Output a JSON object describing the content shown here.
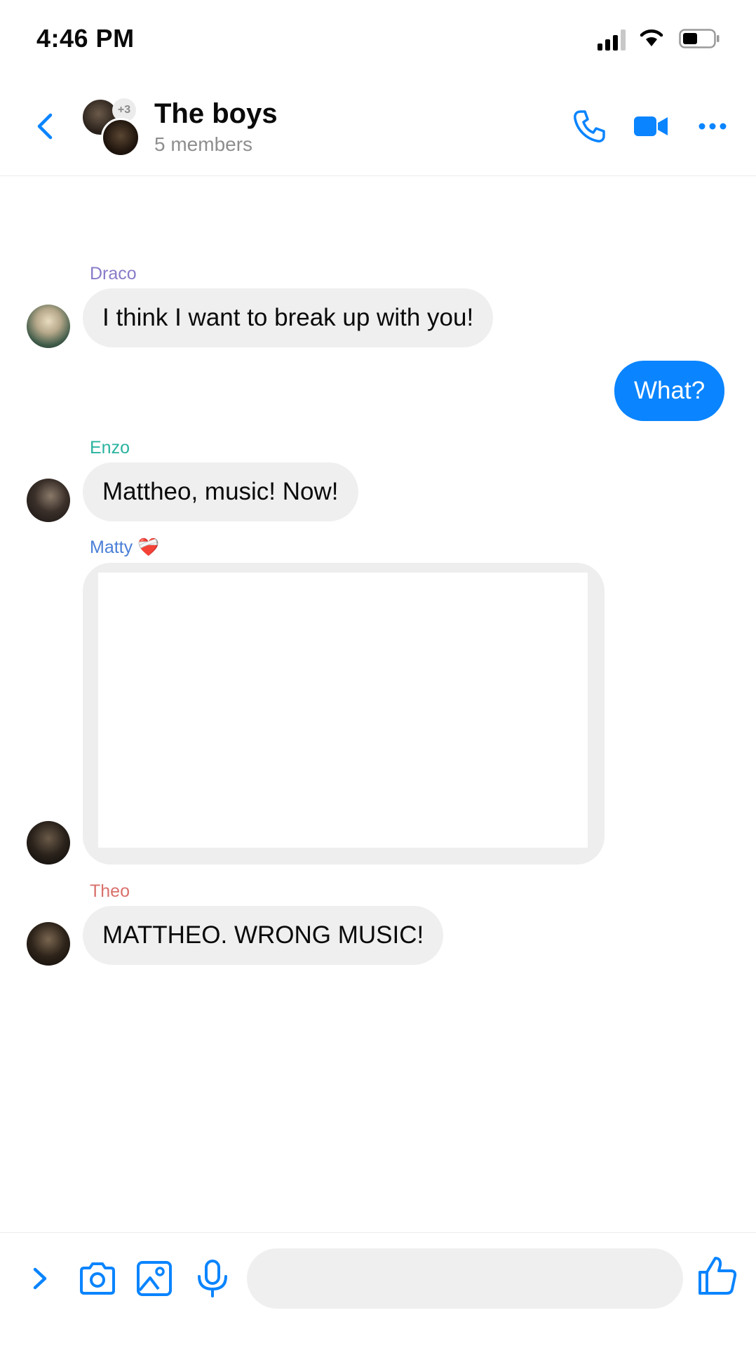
{
  "status_bar": {
    "time": "4:46 PM"
  },
  "header": {
    "title": "The boys",
    "subtitle": "5 members",
    "extra_member_count": "+3"
  },
  "messages": [
    {
      "sender": "Draco",
      "text": "I think I want to break up with you!",
      "direction": "incoming",
      "sender_color": "#8a7bc8"
    },
    {
      "text": "What?",
      "direction": "outgoing"
    },
    {
      "sender": "Enzo",
      "text": "Mattheo, music! Now!",
      "direction": "incoming",
      "sender_color": "#2ab3a0"
    },
    {
      "sender": "Matty ❤️‍🩹",
      "text": "",
      "direction": "incoming",
      "type": "media",
      "sender_color": "#4a7fd6"
    },
    {
      "sender": "Theo",
      "text": "MATTHEO. WRONG MUSIC!",
      "direction": "incoming",
      "sender_color": "#d9706b"
    }
  ],
  "composer": {
    "placeholder": ""
  },
  "colors": {
    "accent": "#0a84ff",
    "bubble_in": "#efefef"
  },
  "icons": {
    "header": [
      "back-chevron-icon",
      "phone-icon",
      "video-camera-icon",
      "more-dots-icon"
    ],
    "composer": [
      "expand-chevron-icon",
      "camera-icon",
      "image-icon",
      "microphone-icon",
      "thumbs-up-icon"
    ]
  }
}
